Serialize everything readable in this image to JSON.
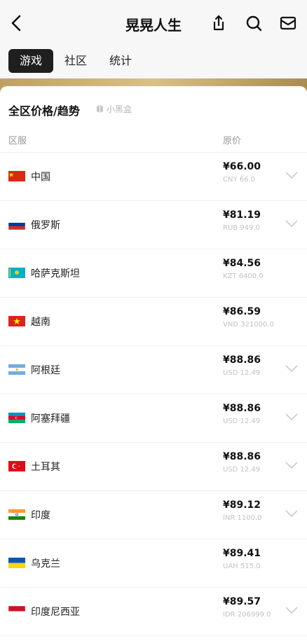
{
  "header": {
    "title": "晃晃人生",
    "icons": [
      "back-icon",
      "share-icon",
      "search-icon",
      "mail-icon"
    ]
  },
  "tabs": [
    {
      "label": "游戏",
      "active": true
    },
    {
      "label": "社区",
      "active": false
    },
    {
      "label": "统计",
      "active": false
    }
  ],
  "sheet": {
    "title": "全区价格/趋势",
    "brand": "小黑盒",
    "columns": {
      "region": "区服",
      "price": "原价"
    }
  },
  "rows": [
    {
      "region": "中国",
      "flag": "cn",
      "price": "¥66.00",
      "original": "CNY 66.0"
    },
    {
      "region": "俄罗斯",
      "flag": "ru",
      "price": "¥81.19",
      "original": "RUB 949.0"
    },
    {
      "region": "哈萨克斯坦",
      "flag": "kz",
      "price": "¥84.56",
      "original": "KZT 6400.0"
    },
    {
      "region": "越南",
      "flag": "vn",
      "price": "¥86.59",
      "original": "VND 321000.0"
    },
    {
      "region": "阿根廷",
      "flag": "ar",
      "price": "¥88.86",
      "original": "USD 12.49"
    },
    {
      "region": "阿塞拜疆",
      "flag": "az",
      "price": "¥88.86",
      "original": "USD 12.49"
    },
    {
      "region": "土耳其",
      "flag": "tr",
      "price": "¥88.86",
      "original": "USD 12.49"
    },
    {
      "region": "印度",
      "flag": "in",
      "price": "¥89.12",
      "original": "INR 1100.0"
    },
    {
      "region": "乌克兰",
      "flag": "ua",
      "price": "¥89.41",
      "original": "UAH 515.0"
    },
    {
      "region": "印度尼西亚",
      "flag": "id",
      "price": "¥89.57",
      "original": "IDR 206999.0"
    }
  ]
}
